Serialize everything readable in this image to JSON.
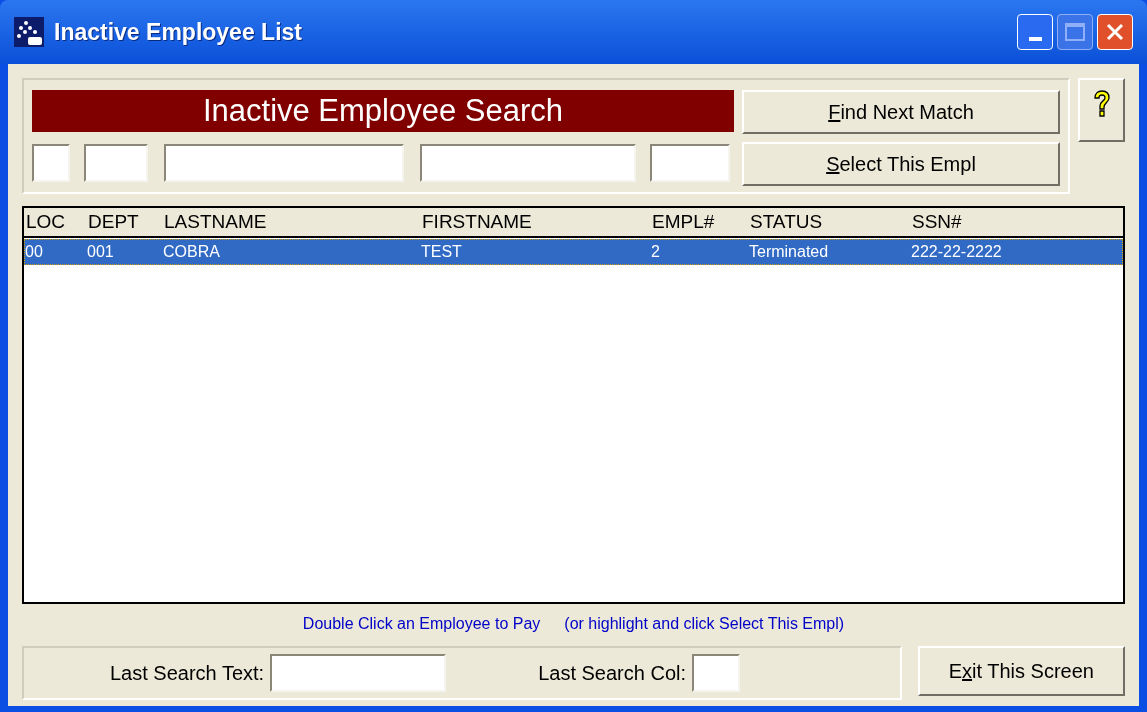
{
  "window": {
    "title": "Inactive Employee List"
  },
  "search": {
    "banner": "Inactive Employee Search",
    "fields": [
      {
        "kind": "text"
      },
      {
        "kind": "text"
      },
      {
        "kind": "text"
      },
      {
        "kind": "text"
      },
      {
        "kind": "text"
      }
    ]
  },
  "buttons": [
    {
      "mnemonic": "F",
      "label_end": "ind Next Match"
    },
    {
      "mnemonic": "S",
      "label_end": "elect This Empl"
    }
  ],
  "table": {
    "columns": [
      "LOC",
      "DEPT",
      "LASTNAME",
      "FIRSTNAME",
      "EMPL#",
      "STATUS",
      "SSN#"
    ],
    "rows": [
      {
        "cells": [
          "00",
          "001",
          "COBRA",
          "TEST",
          "2",
          "Terminated",
          "222-22-2222"
        ],
        "selected": true
      }
    ]
  },
  "hints": [
    "Double Click an Employee to Pay",
    "(or highlight and click Select This Empl)"
  ],
  "footer": {
    "last_search_text_label": "Last Search Text:",
    "last_search_col_label": "Last Search Col:",
    "exit_button": {
      "label_start": "E",
      "mnemonic": "x",
      "label_end": "it This Screen"
    }
  }
}
